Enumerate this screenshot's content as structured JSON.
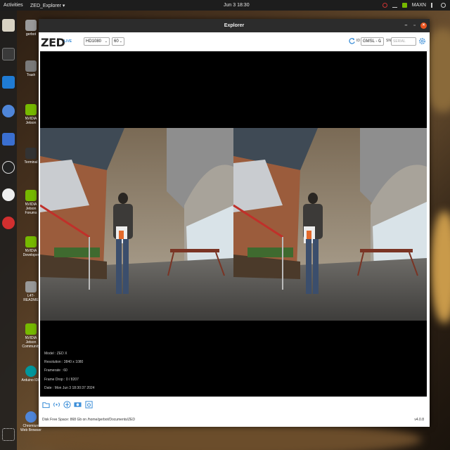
{
  "topbar": {
    "activities": "Activities",
    "app_menu": "ZED_Explorer ▾",
    "clock": "Jun 3  18:30",
    "power_mode": "MAXN"
  },
  "desktop_icons": [
    "gerbot",
    "Trash",
    "NVIDIA Jetson",
    "Terminal",
    "NVIDIA Jetson Forums",
    "NVIDIA Developer",
    "L4T-README",
    "NVIDIA Jetson Community",
    "Arduino IDE",
    "Chromium Web Browser"
  ],
  "window": {
    "title": "Explorer"
  },
  "toolbar": {
    "logo": "ZED",
    "live": "LIVE",
    "resolution": "HD1080",
    "fps": "60",
    "id_label": "ID",
    "camera_id": "GMSL - 0",
    "sn_label": "SN",
    "sn_placeholder": "SERIAL"
  },
  "info": {
    "model": "Model : ZED X",
    "resolution": "Resolution : 3840 x 1080",
    "framerate": "Framerate : 60",
    "frame_drop": "Frame Drop : 0 / 8207",
    "date": "Date : Mon Jun 3 18:30:37 2024"
  },
  "status": {
    "disk": "Disk Free Space: 868 Gb  on /home/gerbot/Documents/ZED",
    "version": "v4.0.8"
  },
  "colors": {
    "accent": "#3b8ed8",
    "close": "#e95420",
    "titlebar": "#2c2c2c"
  },
  "icons": [
    "folder-icon",
    "broadcast-icon",
    "settings-icon",
    "record-icon",
    "snapshot-icon",
    "refresh-icon",
    "gear-icon"
  ]
}
